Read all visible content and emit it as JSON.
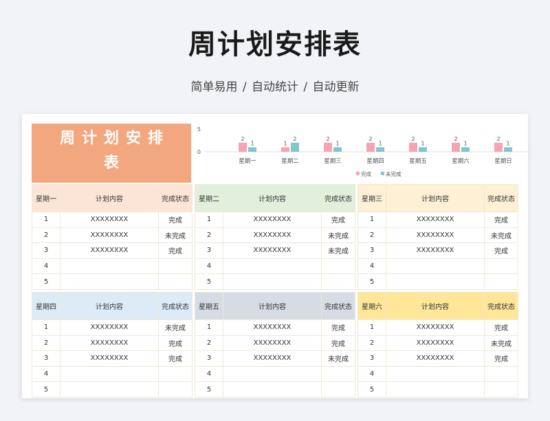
{
  "page": {
    "title": "周计划安排表",
    "subtitle": "简单易用 / 自动统计 / 自动更新"
  },
  "sheet": {
    "title": "周计划安排表"
  },
  "chart_data": {
    "type": "bar",
    "categories": [
      "星期一",
      "星期二",
      "星期三",
      "星期四",
      "星期五",
      "星期六",
      "星期日"
    ],
    "series": [
      {
        "name": "完成",
        "values": [
          2,
          1,
          2,
          2,
          2,
          2,
          2
        ],
        "color": "#f6a5ae"
      },
      {
        "name": "未完成",
        "values": [
          1,
          2,
          1,
          1,
          1,
          1,
          1
        ],
        "color": "#7fc6cd"
      }
    ],
    "y_ticks": [
      0,
      5
    ],
    "ylim": [
      0,
      5
    ],
    "legend_position": "bottom"
  },
  "panels": [
    {
      "day": "星期一",
      "header_color": "#fce4d6",
      "content_header": "计划内容",
      "status_header": "完成状态",
      "rows": [
        [
          "1",
          "XXXXXXXX",
          "完成"
        ],
        [
          "2",
          "XXXXXXXX",
          "未完成"
        ],
        [
          "3",
          "XXXXXXXX",
          "完成"
        ],
        [
          "4",
          "",
          ""
        ],
        [
          "5",
          "",
          ""
        ]
      ]
    },
    {
      "day": "星期二",
      "header_color": "#e2efda",
      "content_header": "计划内容",
      "status_header": "完成状态",
      "rows": [
        [
          "1",
          "XXXXXXXX",
          "完成"
        ],
        [
          "2",
          "XXXXXXXX",
          "未完成"
        ],
        [
          "3",
          "XXXXXXXX",
          "未完成"
        ],
        [
          "4",
          "",
          ""
        ],
        [
          "5",
          "",
          ""
        ]
      ]
    },
    {
      "day": "星期三",
      "header_color": "#fdf0d5",
      "content_header": "计划内容",
      "status_header": "完成状态",
      "rows": [
        [
          "1",
          "XXXXXXXX",
          "完成"
        ],
        [
          "2",
          "XXXXXXXX",
          "未完成"
        ],
        [
          "3",
          "XXXXXXXX",
          "完成"
        ],
        [
          "4",
          "",
          ""
        ],
        [
          "5",
          "",
          ""
        ]
      ]
    },
    {
      "day": "星期四",
      "header_color": "#ddebf7",
      "content_header": "计划内容",
      "status_header": "完成状态",
      "rows": [
        [
          "1",
          "XXXXXXXX",
          "未完成"
        ],
        [
          "2",
          "XXXXXXXX",
          "完成"
        ],
        [
          "3",
          "XXXXXXXX",
          "完成"
        ],
        [
          "4",
          "",
          ""
        ],
        [
          "5",
          "",
          ""
        ]
      ]
    },
    {
      "day": "星期五",
      "header_color": "#d6dce4",
      "content_header": "计划内容",
      "status_header": "完成状态",
      "rows": [
        [
          "1",
          "XXXXXXXX",
          "完成"
        ],
        [
          "2",
          "XXXXXXXX",
          "完成"
        ],
        [
          "3",
          "XXXXXXXX",
          "未完成"
        ],
        [
          "4",
          "",
          ""
        ],
        [
          "5",
          "",
          ""
        ]
      ]
    },
    {
      "day": "星期六",
      "header_color": "#ffe699",
      "content_header": "计划内容",
      "status_header": "完成状态",
      "rows": [
        [
          "1",
          "XXXXXXXX",
          "完成"
        ],
        [
          "2",
          "XXXXXXXX",
          "未完成"
        ],
        [
          "3",
          "XXXXXXXX",
          "完成"
        ],
        [
          "4",
          "",
          ""
        ],
        [
          "5",
          "",
          ""
        ]
      ]
    }
  ]
}
